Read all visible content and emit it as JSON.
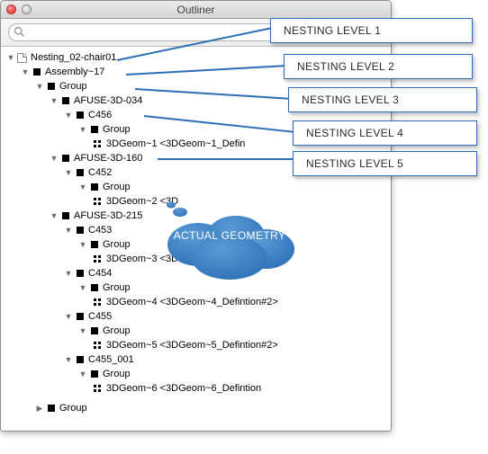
{
  "window": {
    "title": "Outliner"
  },
  "search": {
    "placeholder": ""
  },
  "tree": {
    "root": "Nesting_02-chair01",
    "assembly": "Assembly~17",
    "group": "Group",
    "items": [
      {
        "name": "AFUSE-3D-034",
        "children": [
          {
            "name": "C456",
            "group": "Group",
            "geom": "3DGeom~1 <3DGeom~1_Defin"
          }
        ]
      },
      {
        "name": "AFUSE-3D-160",
        "children": [
          {
            "name": "C452",
            "group": "Group",
            "geom": "3DGeom~2 <3D"
          }
        ]
      },
      {
        "name": "AFUSE-3D-215",
        "children": [
          {
            "name": "C453",
            "group": "Group",
            "geom": "3DGeom~3 <3DGeom~3_Defintion#2>"
          },
          {
            "name": "C454",
            "group": "Group",
            "geom": "3DGeom~4 <3DGeom~4_Defintion#2>"
          },
          {
            "name": "C455",
            "group": "Group",
            "geom": "3DGeom~5 <3DGeom~5_Defintion#2>"
          },
          {
            "name": "C455_001",
            "group": "Group",
            "geom": "3DGeom~6 <3DGeom~6_Defintion"
          }
        ]
      }
    ],
    "trailing_group": "Group"
  },
  "annotations": {
    "level1": "NESTING LEVEL 1",
    "level2": "NESTING LEVEL 2",
    "level3": "NESTING LEVEL 3",
    "level4": "NESTING LEVEL 4",
    "level5": "NESTING LEVEL 5",
    "geometry": "ACTUAL GEOMETRY"
  },
  "colors": {
    "accent": "#2b6fb6"
  }
}
